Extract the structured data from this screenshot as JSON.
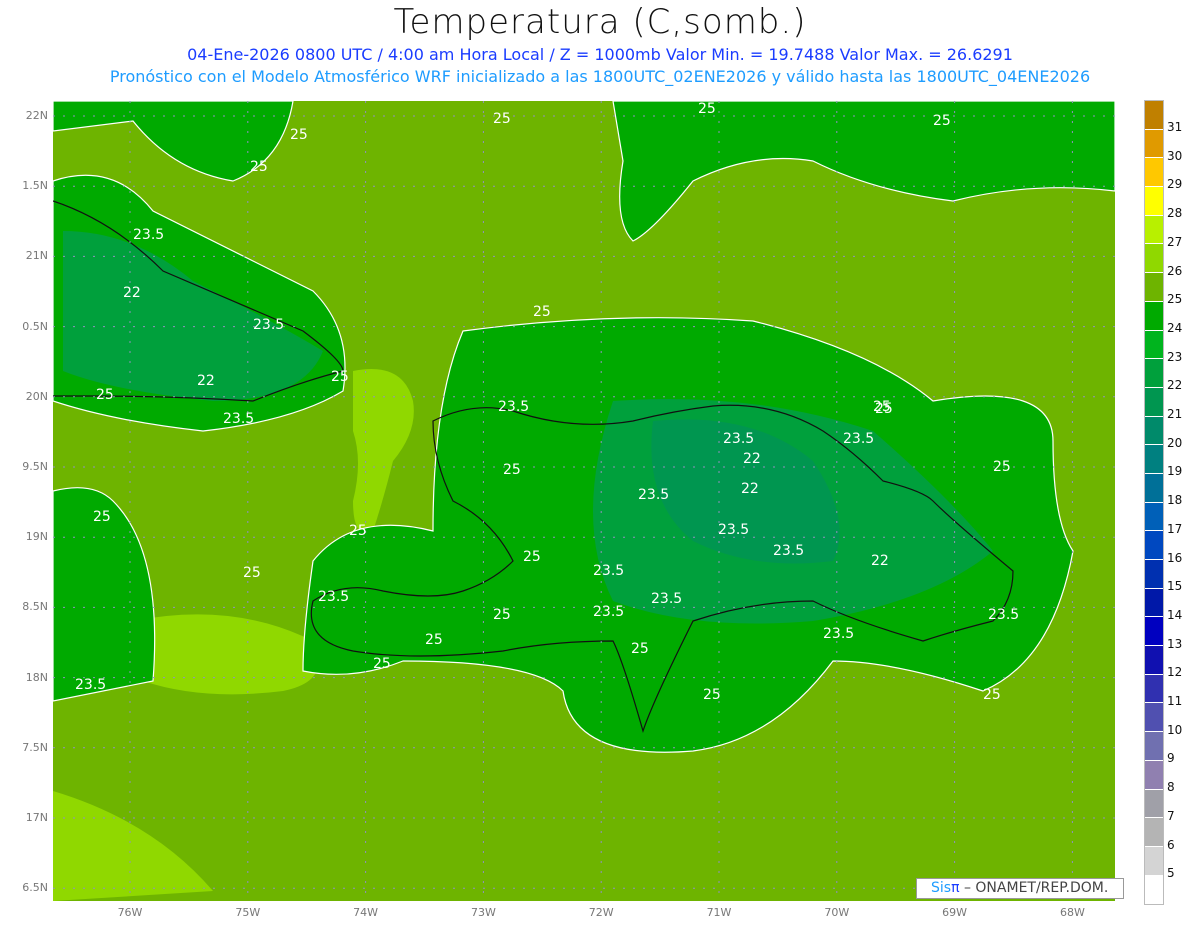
{
  "title": "Temperatura (C,somb.)",
  "subtitle_line1": "04-Ene-2026  0800 UTC / 4:00 am Hora Local / Z = 1000mb   Valor Min. = 19.7488  Valor Max. = 26.6291",
  "subtitle_line2": "Pronóstico con el Modelo Atmosférico WRF inicializado a las 1800UTC_02ENE2026 y válido hasta las  1800UTC_04ENE2026",
  "lat_labels": [
    "22N",
    "1.5N",
    "21N",
    "0.5N",
    "20N",
    "9.5N",
    "19N",
    "8.5N",
    "18N",
    "7.5N",
    "17N",
    "6.5N"
  ],
  "lon_labels": [
    "76W",
    "75W",
    "74W",
    "73W",
    "72W",
    "71W",
    "70W",
    "69W",
    "68W"
  ],
  "colorbar": {
    "labels": [
      "31",
      "30",
      "29",
      "28",
      "27",
      "26",
      "25",
      "24",
      "23",
      "22",
      "21",
      "20",
      "19",
      "18",
      "17",
      "16",
      "15",
      "14",
      "13",
      "12",
      "11",
      "10",
      "9",
      "8",
      "7",
      "6",
      "5"
    ],
    "colors": [
      "#c08000",
      "#e09a00",
      "#ffc800",
      "#ffff00",
      "#b8f000",
      "#90d800",
      "#6eb400",
      "#00aa00",
      "#00b41e",
      "#00a03c",
      "#009650",
      "#008a6a",
      "#008080",
      "#007098",
      "#0060b8",
      "#0048c0",
      "#0030b0",
      "#0018a8",
      "#0000c0",
      "#1010b0",
      "#3030b0",
      "#5050b0",
      "#7070b0",
      "#9080b0",
      "#a0a0a8",
      "#b4b4b4",
      "#d4d4d4",
      "#ffffff"
    ]
  },
  "contour_labels": [
    "25",
    "25",
    "25",
    "25",
    "25",
    "23.5",
    "22",
    "23.5",
    "22",
    "23.5",
    "25",
    "25",
    "25",
    "25",
    "23.5",
    "25",
    "23.5",
    "23.5",
    "22",
    "22",
    "23.5",
    "25",
    "25",
    "25",
    "23.5",
    "23.5",
    "23.5",
    "22",
    "23.5",
    "23.5",
    "25",
    "25",
    "23.5",
    "25",
    "25",
    "25",
    "25",
    "25",
    "23.5",
    "23.5",
    "25",
    "23.5",
    "25"
  ],
  "credit": {
    "sis": "Sis",
    "pi": "π",
    "org": " –  ONAMET/REP.DOM."
  }
}
